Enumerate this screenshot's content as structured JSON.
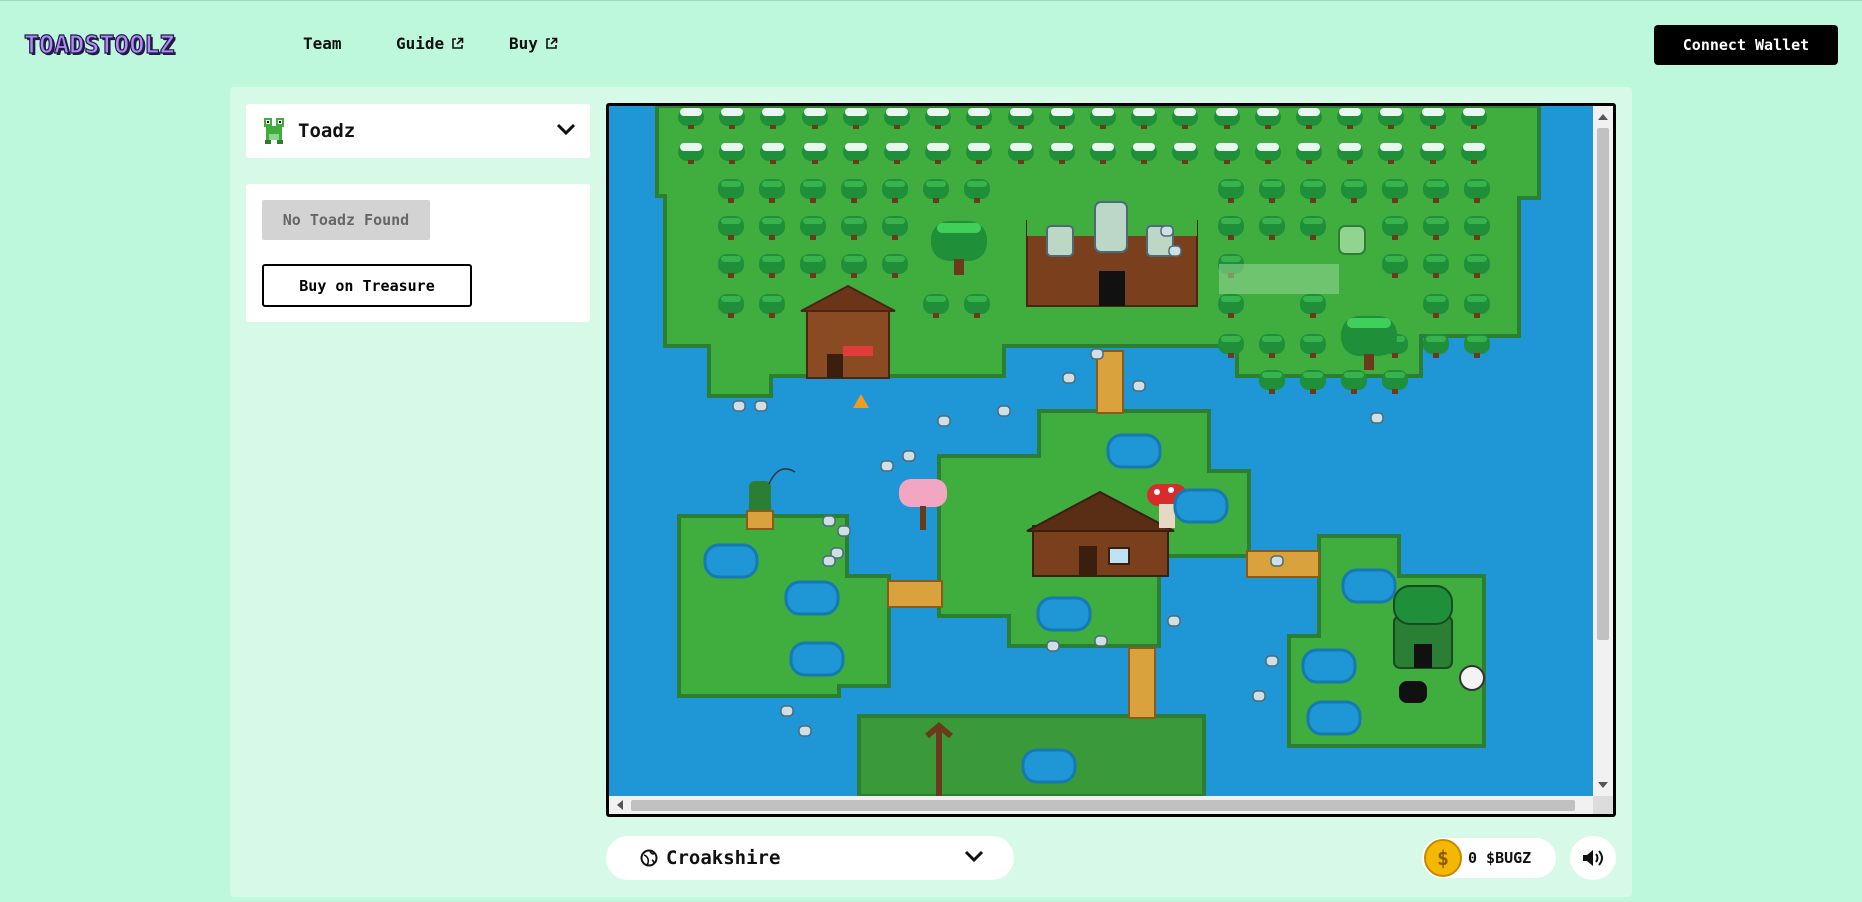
{
  "header": {
    "logo": "TOADSTOOLZ",
    "nav": [
      {
        "label": "Team",
        "external": false
      },
      {
        "label": "Guide",
        "external": true
      },
      {
        "label": "Buy",
        "external": true
      }
    ],
    "connect_label": "Connect Wallet"
  },
  "sidebar": {
    "collection_label": "Toadz",
    "empty_label": "No Toadz Found",
    "buy_label": "Buy on Treasure"
  },
  "footer": {
    "world_label": "Croakshire",
    "bugz_value": "0 $BUGZ",
    "coin_symbol": "$"
  },
  "icons": {
    "logo": "toadstoolz-logo",
    "collection": "frog-icon",
    "dropdown": "chevron-down-icon",
    "external": "external-link-icon",
    "world": "globe-icon",
    "currency": "bugz-coin-icon",
    "sound": "speaker-icon"
  },
  "colors": {
    "background": "#bdf8dc",
    "panel": "#d6f9e8",
    "water": "#1f96d6",
    "grass": "#3fae3f",
    "tree": "#1f8f3a",
    "coin": "#f5b800",
    "logo": "#b08cf6"
  }
}
